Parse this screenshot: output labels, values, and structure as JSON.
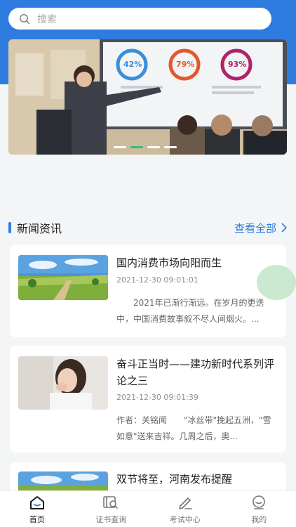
{
  "search": {
    "placeholder": "搜索"
  },
  "banner": {
    "stats": [
      "42%",
      "79%",
      "93%"
    ],
    "dot_count": 4,
    "active_dot": 1
  },
  "news": {
    "section_title": "新闻资讯",
    "view_all": "查看全部",
    "items": [
      {
        "title": "国内消费市场向阳而生",
        "date": "2021-12-30 09:01:01",
        "excerpt": "　　2021年已渐行渐远。在岁月的更迭中，中国消费故事叙不尽人间烟火。..."
      },
      {
        "title": "奋斗正当时——建功新时代系列评论之三",
        "date": "2021-12-30 09:01:39",
        "excerpt": "作者：关铭闻　　\"冰丝带\"挽起五洲，\"雪如意\"送来吉祥。几周之后，奥..."
      },
      {
        "title": "双节将至，河南发布提醒",
        "date": "",
        "excerpt": ""
      }
    ]
  },
  "tabbar": {
    "items": [
      {
        "label": "首页",
        "icon": "home-icon",
        "active": true
      },
      {
        "label": "证书查询",
        "icon": "certificate-search-icon",
        "active": false
      },
      {
        "label": "考试中心",
        "icon": "pencil-icon",
        "active": false
      },
      {
        "label": "我的",
        "icon": "profile-icon",
        "active": false
      }
    ]
  },
  "colors": {
    "brand": "#2f7ce0",
    "active_dot": "#2fbf7a",
    "background": "#f4f5f7"
  }
}
